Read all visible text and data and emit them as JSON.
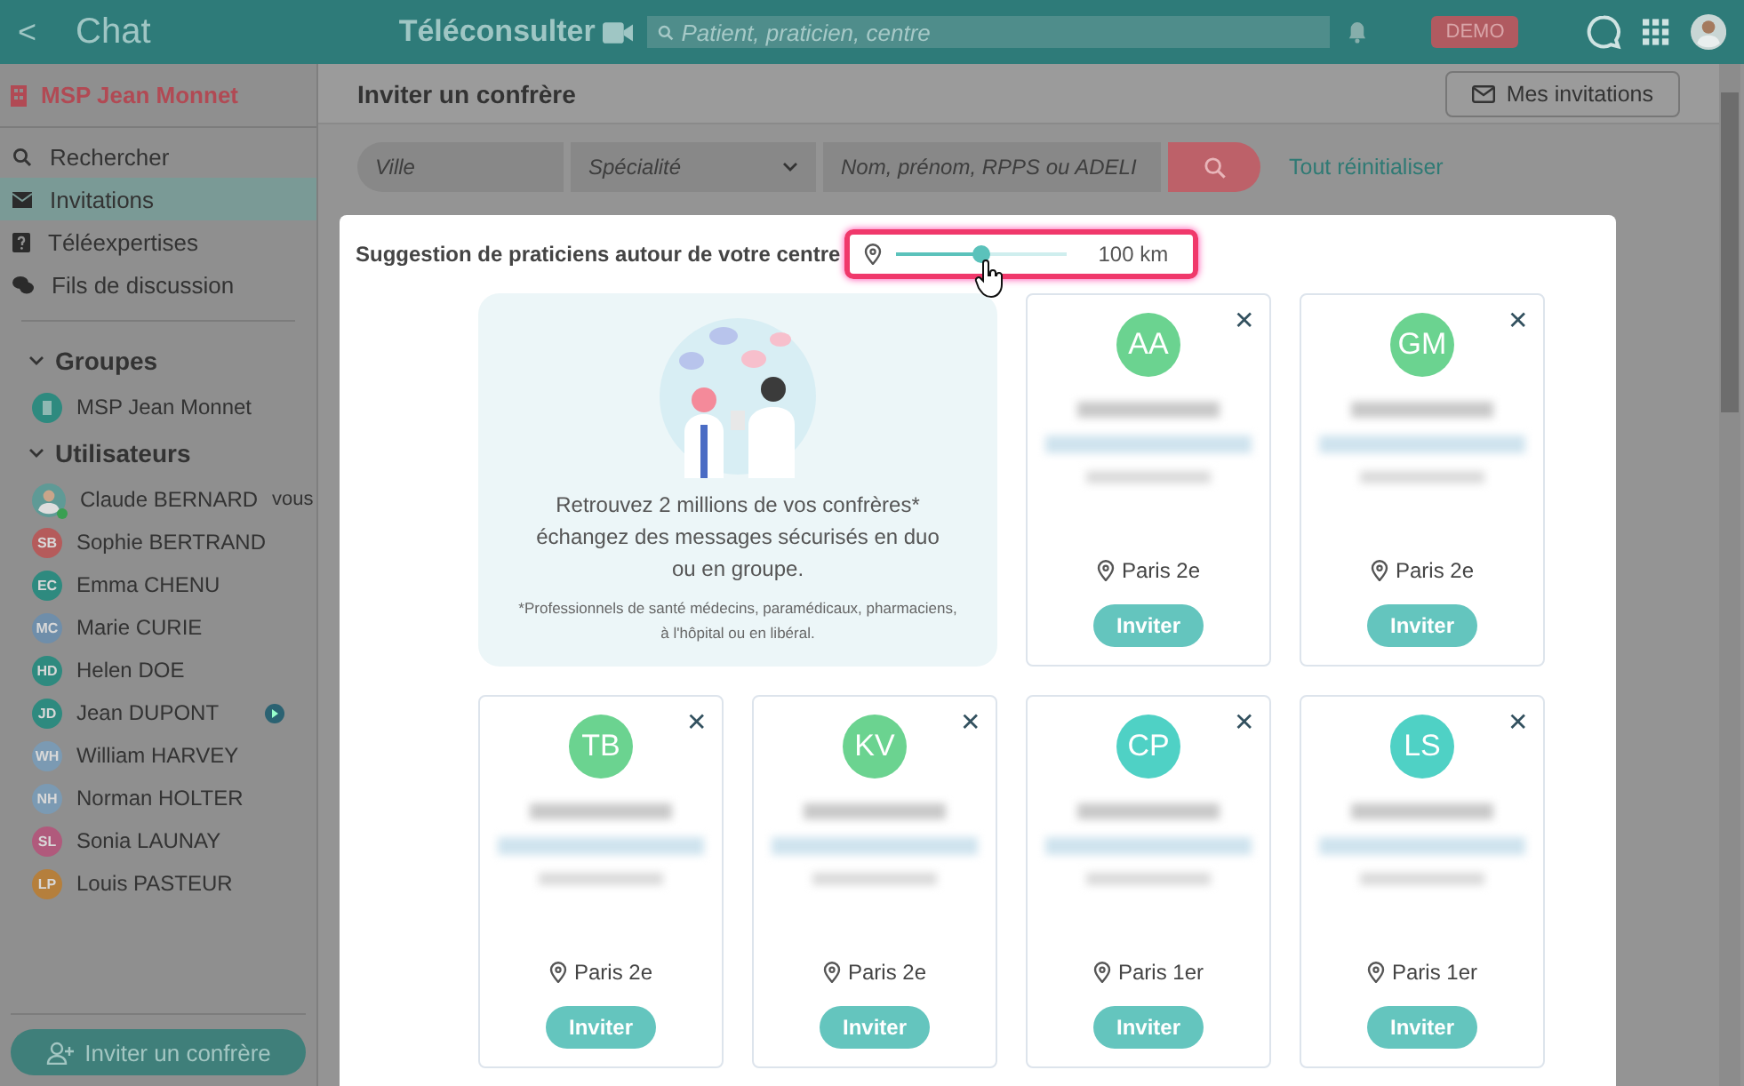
{
  "topbar": {
    "back": "<",
    "title": "Chat",
    "brand": "Téléconsulter",
    "search_placeholder": "Patient, praticien, centre",
    "badge": "DEMO"
  },
  "sidebar": {
    "center": "MSP Jean Monnet",
    "nav": [
      {
        "label": "Rechercher",
        "selected": false
      },
      {
        "label": "Invitations",
        "selected": true
      },
      {
        "label": "Téléexpertises",
        "selected": false
      },
      {
        "label": "Fils de discussion",
        "selected": false
      }
    ],
    "groups_title": "Groupes",
    "groups": [
      {
        "name": "MSP Jean Monnet"
      }
    ],
    "users_title": "Utilisateurs",
    "users": [
      {
        "name": "Claude BERNARD",
        "kind": "photo",
        "tag": "vous",
        "online": true
      },
      {
        "name": "Sophie BERTRAND",
        "kind": "initials",
        "initials": "SB",
        "color": "#b55b5b"
      },
      {
        "name": "Emma CHENU",
        "kind": "initials",
        "initials": "EC",
        "color": "#2e8a7f"
      },
      {
        "name": "Marie CURIE",
        "kind": "initials",
        "initials": "MC",
        "color": "#6f8eaa"
      },
      {
        "name": "Helen DOE",
        "kind": "initials",
        "initials": "HD",
        "color": "#2e8a7f"
      },
      {
        "name": "Jean DUPONT",
        "kind": "initials",
        "initials": "JD",
        "color": "#2e8a7f",
        "unread": true
      },
      {
        "name": "William HARVEY",
        "kind": "initials",
        "initials": "WH",
        "color": "#7b9ab3"
      },
      {
        "name": "Norman HOLTER",
        "kind": "initials",
        "initials": "NH",
        "color": "#7b9ab3"
      },
      {
        "name": "Sonia LAUNAY",
        "kind": "initials",
        "initials": "SL",
        "color": "#b05a7c"
      },
      {
        "name": "Louis PASTEUR",
        "kind": "initials",
        "initials": "LP",
        "color": "#b57f3c"
      }
    ],
    "invite_button": "Inviter un confrère"
  },
  "main": {
    "title": "Inviter un confrère",
    "my_invitations": "Mes invitations",
    "filters": {
      "city_placeholder": "Ville",
      "specialty_placeholder": "Spécialité",
      "name_placeholder": "Nom, prénom, RPPS ou ADELI",
      "reset": "Tout réinitialiser"
    },
    "suggestions": {
      "title": "Suggestion de praticiens autour de votre centre",
      "radius": {
        "level": 0.5,
        "reading": "100 km"
      },
      "info": {
        "headline": "Retrouvez 2 millions de vos confrères* échangez des messages sécurisés en duo ou en groupe.",
        "note": "*Professionnels de santé médecins, paramédicaux, pharmaciens, à l'hôpital ou en libéral."
      },
      "cards": [
        {
          "close": "✕",
          "initials": "AA",
          "color": "#6bd390",
          "location": "Paris 2e",
          "action": "Inviter"
        },
        {
          "close": "✕",
          "initials": "GM",
          "color": "#6bd390",
          "location": "Paris 2e",
          "action": "Inviter"
        },
        {
          "close": "✕",
          "initials": "TB",
          "color": "#6bd390",
          "location": "Paris 2e",
          "action": "Inviter"
        },
        {
          "close": "✕",
          "initials": "KV",
          "color": "#6bd390",
          "location": "Paris 2e",
          "action": "Inviter"
        },
        {
          "close": "✕",
          "initials": "CP",
          "color": "#4fd1c5",
          "location": "Paris 1er",
          "action": "Inviter"
        },
        {
          "close": "✕",
          "initials": "LS",
          "color": "#4fd1c5",
          "location": "Paris 1er",
          "action": "Inviter"
        }
      ]
    }
  }
}
